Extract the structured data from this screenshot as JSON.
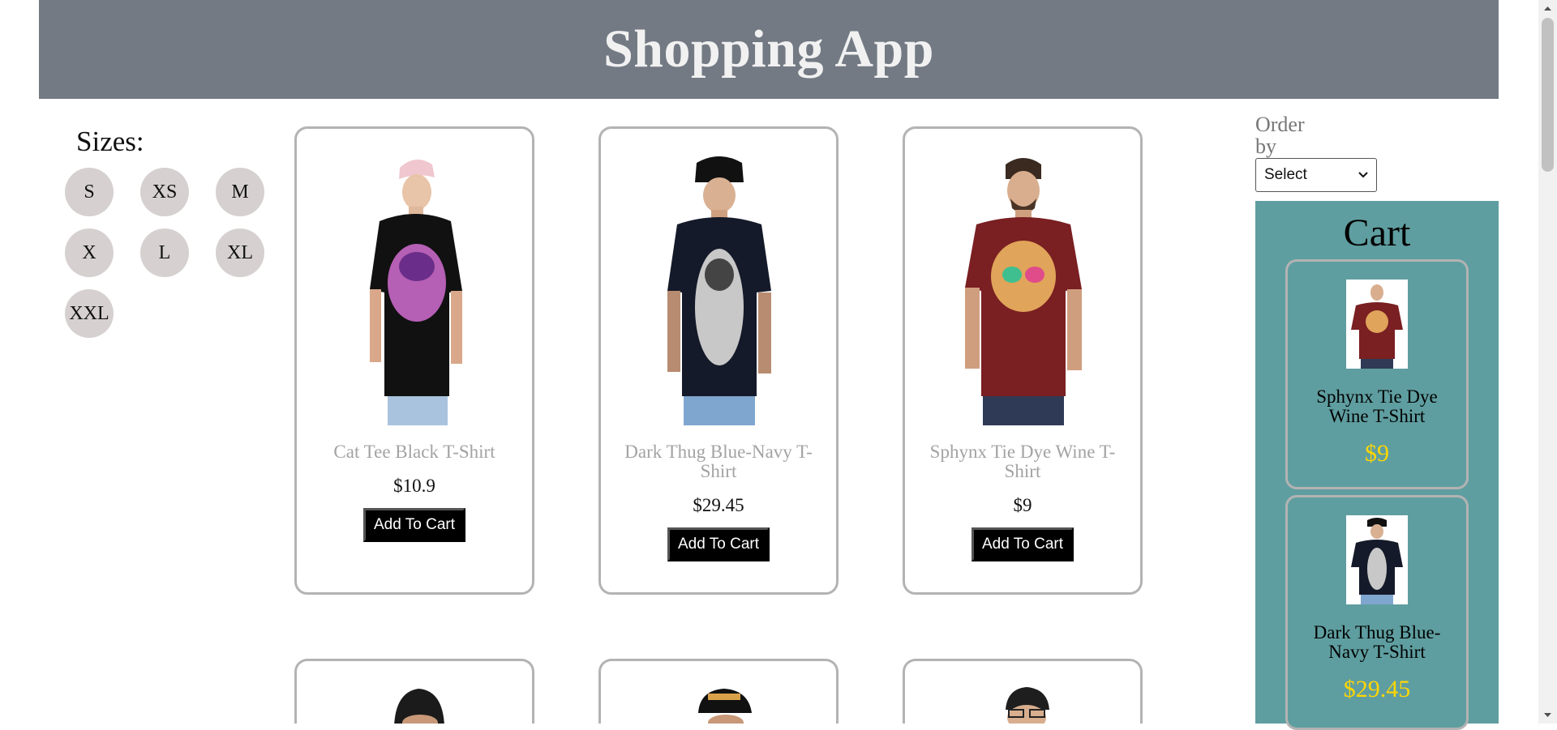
{
  "header": {
    "title": "Shopping App"
  },
  "filters": {
    "title": "Sizes:",
    "sizes": [
      "S",
      "XS",
      "M",
      "X",
      "L",
      "XL",
      "XXL"
    ]
  },
  "products": [
    {
      "name": "Cat Tee Black T-Shirt",
      "price": "$10.9",
      "button": "Add To Cart"
    },
    {
      "name": "Dark Thug Blue-Navy T-Shirt",
      "price": "$29.45",
      "button": "Add To Cart"
    },
    {
      "name": "Sphynx Tie Dye Wine T-Shirt",
      "price": "$9",
      "button": "Add To Cart"
    }
  ],
  "order": {
    "label": "Order by",
    "selected": "Select"
  },
  "cart": {
    "title": "Cart",
    "items": [
      {
        "name": "Sphynx Tie Dye Wine T-Shirt",
        "price": "$9"
      },
      {
        "name": "Dark Thug Blue-Navy T-Shirt",
        "price": "$29.45"
      }
    ]
  },
  "colors": {
    "header_bg": "#737a84",
    "cart_bg": "#5f9ea0",
    "cart_price": "#ffd700",
    "size_chip": "#d6d0d0"
  }
}
